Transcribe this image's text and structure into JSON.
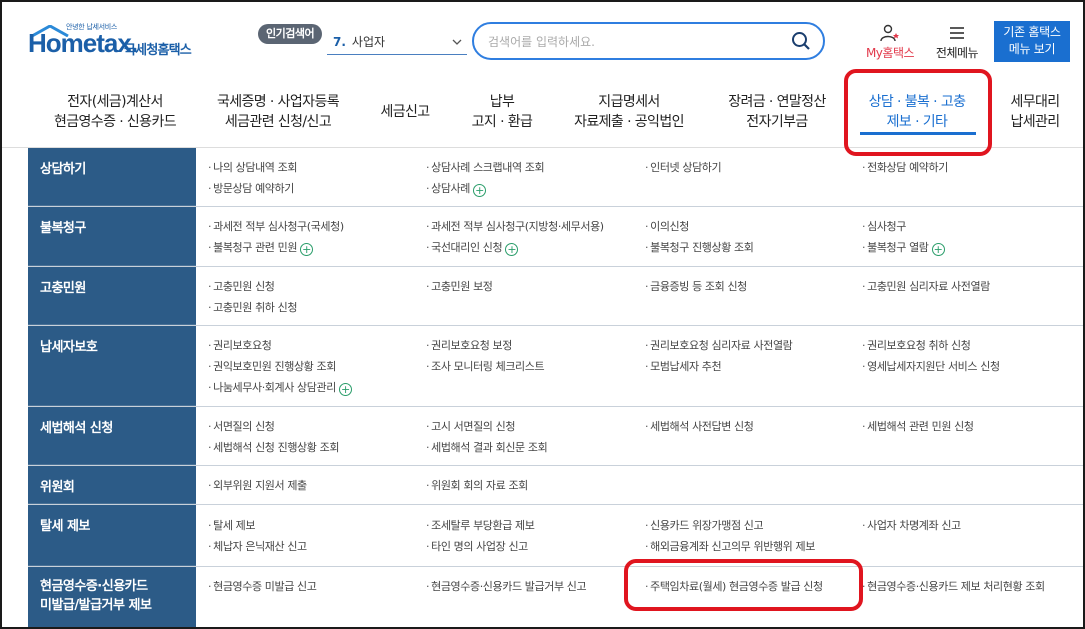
{
  "header": {
    "logo_tagline": "안녕한 납세서비스",
    "logo_brand": "Hometax.",
    "logo_sub": "국세청홈택스",
    "popular_badge": "인기검색어",
    "popular_rank": "7.",
    "popular_term": "사업자",
    "search_placeholder": "검색어를 입력하세요.",
    "my_hometax": "My홈택스",
    "all_menu": "전체메뉴",
    "old_home_line1": "기존 홈택스",
    "old_home_line2": "메뉴 보기"
  },
  "nav": [
    {
      "line1": "전자(세금)계산서",
      "line2": "현금영수증 · 신용카드"
    },
    {
      "line1": "국세증명 · 사업자등록",
      "line2": "세금관련 신청/신고"
    },
    {
      "line1": "세금신고",
      "line2": ""
    },
    {
      "line1": "납부",
      "line2": "고지 · 환급"
    },
    {
      "line1": "지급명세서",
      "line2": "자료제출 · 공익법인"
    },
    {
      "line1": "장려금 · 연말정산",
      "line2": "전자기부금"
    },
    {
      "line1": "상담 · 불복 · 고충",
      "line2": "제보 · 기타"
    },
    {
      "line1": "세무대리",
      "line2": "납세관리"
    }
  ],
  "rows": [
    {
      "cat": "상담하기",
      "cells": [
        [
          "나의 상담내역 조회",
          "방문상담 예약하기"
        ],
        [
          "상담사례 스크랩내역 조회",
          "상담사례"
        ],
        [
          "인터넷 상담하기"
        ],
        [
          "전화상담 예약하기"
        ]
      ]
    },
    {
      "cat": "불복청구",
      "cells": [
        [
          "과세전 적부 심사청구(국세청)",
          "불복청구 관련 민원"
        ],
        [
          "과세전 적부 심사청구(지방청·세무서용)",
          "국선대리인 신청"
        ],
        [
          "이의신청",
          "불복청구 진행상황 조회"
        ],
        [
          "심사청구",
          "불복청구 열람"
        ]
      ]
    },
    {
      "cat": "고충민원",
      "cells": [
        [
          "고충민원 신청",
          "고충민원 취하 신청"
        ],
        [
          "고충민원 보정"
        ],
        [
          "금융증빙 등 조회 신청"
        ],
        [
          "고충민원 심리자료 사전열람"
        ]
      ]
    },
    {
      "cat": "납세자보호",
      "cells": [
        [
          "권리보호요청",
          "권익보호민원 진행상황 조회",
          "나눔세무사·회계사 상담관리"
        ],
        [
          "권리보호요청 보정",
          "조사 모니터링 체크리스트"
        ],
        [
          "권리보호요청 심리자료 사전열람",
          "모범납세자 추천"
        ],
        [
          "권리보호요청 취하 신청",
          "영세납세자지원단 서비스 신청"
        ]
      ]
    },
    {
      "cat": "세법해석 신청",
      "cells": [
        [
          "서면질의 신청",
          "세법해석 신청 진행상황 조회"
        ],
        [
          "고시 서면질의 신청",
          "세법해석 결과 회신문 조회"
        ],
        [
          "세법해석 사전답변 신청"
        ],
        [
          "세법해석 관련 민원 신청"
        ]
      ]
    },
    {
      "cat": "위원회",
      "cells": [
        [
          "외부위원 지원서 제출"
        ],
        [
          "위원회 회의 자료 조회"
        ],
        [],
        []
      ]
    },
    {
      "cat": "탈세 제보",
      "cells": [
        [
          "탈세 제보",
          "체납자 은닉재산 신고"
        ],
        [
          "조세탈루 부당환급 제보",
          "타인 명의 사업장 신고"
        ],
        [
          "신용카드 위장가맹점 신고",
          "해외금융계좌 신고의무 위반행위 제보"
        ],
        [
          "사업자 차명계좌 신고"
        ]
      ]
    },
    {
      "cat": "현금영수증·신용카드 미발급/발급거부 제보",
      "cat_line1": "현금영수증·신용카드",
      "cat_line2": "미발급/발급거부 제보",
      "cells": [
        [
          "현금영수증 미발급 신고"
        ],
        [
          "현금영수증·신용카드 발급거부 신고"
        ],
        [
          "주택임차료(월세) 현금영수증 발급 신청"
        ],
        [
          "현금영수증·신용카드 제보 처리현황 조회"
        ]
      ]
    }
  ]
}
